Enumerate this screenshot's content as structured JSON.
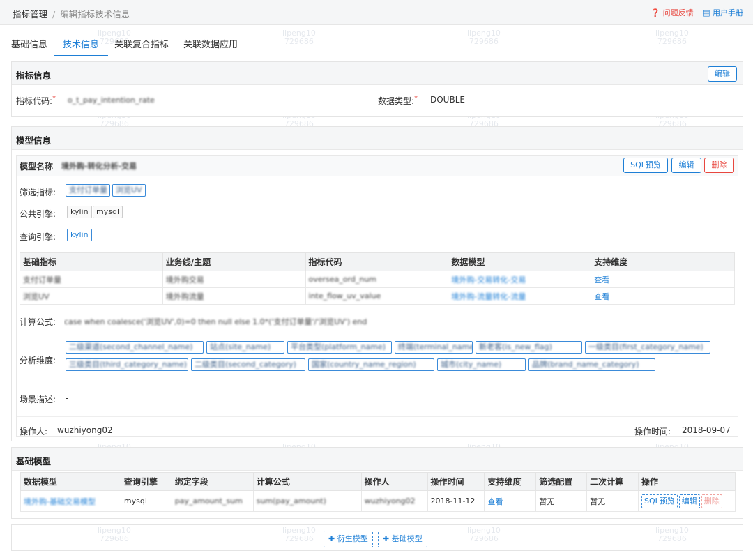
{
  "breadcrumb": {
    "root": "指标管理",
    "sep": "/",
    "current": "编辑指标技术信息"
  },
  "toplinks": {
    "feedback": "问题反馈",
    "manual": "用户手册"
  },
  "tabs": [
    "基础信息",
    "技术信息",
    "关联复合指标",
    "关联数据应用"
  ],
  "indicator_panel": {
    "title": "指标信息",
    "edit": "编辑",
    "code_label": "指标代码:",
    "code_value": "o_t_pay_intention_rate",
    "type_label": "数据类型:",
    "type_value": "DOUBLE"
  },
  "model_panel": {
    "title": "模型信息",
    "name_label": "模型名称",
    "name_value": "境外购-转化分析-交易",
    "sql_btn": "SQL预览",
    "edit_btn": "编辑",
    "delete_btn": "删除",
    "filter_label": "筛选指标:",
    "filter_tags": [
      "支付订单量",
      "浏览UV"
    ],
    "public_engine_label": "公共引擎:",
    "public_engines": [
      "kylin",
      "mysql"
    ],
    "query_engine_label": "查询引擎:",
    "query_engine": "kylin",
    "table_headers": [
      "基础指标",
      "业务线/主题",
      "指标代码",
      "数据模型",
      "支持维度"
    ],
    "rows": [
      {
        "base": "支付订单量",
        "line": "境外购交易",
        "code": "oversea_ord_num",
        "model": "境外购-交易转化-交易",
        "dim": "查看"
      },
      {
        "base": "浏览UV",
        "line": "境外购流量",
        "code": "inte_flow_uv_value",
        "model": "境外购-流量转化-流量",
        "dim": "查看"
      }
    ],
    "formula_label": "计算公式:",
    "formula_value": "case when coalesce('浏览UV',0)=0 then null else 1.0*('支付订单量'/'浏览UV') end",
    "dims_label": "分析维度:",
    "dims_row1": [
      "二级渠道(second_channel_name)",
      "站点(site_name)",
      "平台类型(platform_name)",
      "终端(terminal_name)",
      "新老客(is_new_flag)",
      "一级类目(first_category_name)"
    ],
    "dims_row2": [
      "三级类目(third_category_name)",
      "二级类目(second_category)",
      "国家(country_name_region)",
      "城市(city_name)",
      "品牌(brand_name_category)"
    ],
    "scene_label": "场景描述:",
    "scene_value": "-",
    "operator_label": "操作人:",
    "operator_value": "wuzhiyong02",
    "optime_label": "操作时间:",
    "optime_value": "2018-09-07"
  },
  "base_panel": {
    "title": "基础模型",
    "headers": [
      "数据模型",
      "查询引擎",
      "绑定字段",
      "计算公式",
      "操作人",
      "操作时间",
      "支持维度",
      "筛选配置",
      "二次计算",
      "操作"
    ],
    "row": {
      "model": "境外购-基础交易模型",
      "engine": "mysql",
      "field": "pay_amount_sum",
      "formula": "sum(pay_amount)",
      "operator": "wuzhiyong02",
      "time": "2018-11-12",
      "dim": "查看",
      "filter": "暂无",
      "calc": "暂无",
      "sql": "SQL预览",
      "edit": "编辑",
      "delete": "删除"
    }
  },
  "footer": {
    "derive": "衍生模型",
    "base": "基础模型"
  },
  "watermark": {
    "name": "lipeng10",
    "id": "729686"
  },
  "colors": {
    "accent": "#1e7fd6",
    "danger": "#e8473f"
  }
}
